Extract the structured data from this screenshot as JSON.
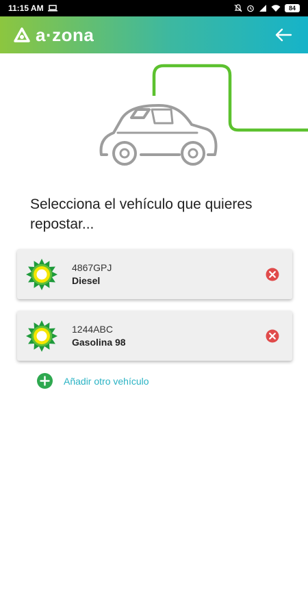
{
  "status_bar": {
    "time": "11:15 AM",
    "battery": "84"
  },
  "header": {
    "logo_text": "a·zona",
    "back_icon": "arrow-left-icon"
  },
  "colors": {
    "brand_green": "#8cc63f",
    "brand_teal": "#16b3c9",
    "remove_red": "#e04b4b",
    "add_green": "#2ea84f",
    "link_teal": "#2ab3c4"
  },
  "main": {
    "prompt": "Selecciona el vehículo que quieres repostar...",
    "vehicles": [
      {
        "plate": "4867GPJ",
        "fuel": "Diesel",
        "icon": "bp-helios-icon"
      },
      {
        "plate": "1244ABC",
        "fuel": "Gasolina 98",
        "icon": "bp-helios-icon"
      }
    ],
    "add_vehicle_label": "Añadir otro vehículo"
  }
}
